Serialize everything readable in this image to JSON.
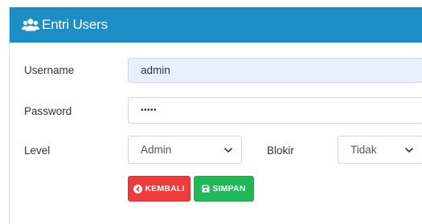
{
  "panel": {
    "title": "Entri Users",
    "title_icon": "users-icon"
  },
  "form": {
    "username": {
      "label": "Username",
      "value": "admin"
    },
    "password": {
      "label": "Password",
      "value": "•••••"
    },
    "level": {
      "label": "Level",
      "value": "Admin"
    },
    "blokir": {
      "label": "Blokir",
      "value": "Tidak"
    }
  },
  "buttons": {
    "back": {
      "label": "KEMBALI",
      "icon": "arrow-left-circle-icon",
      "color": "#ee3b3b"
    },
    "save": {
      "label": "SIMPAN",
      "icon": "save-icon",
      "color": "#22b85a"
    }
  },
  "colors": {
    "header": "#1d8dc6",
    "autofill": "#e8f0fe"
  }
}
